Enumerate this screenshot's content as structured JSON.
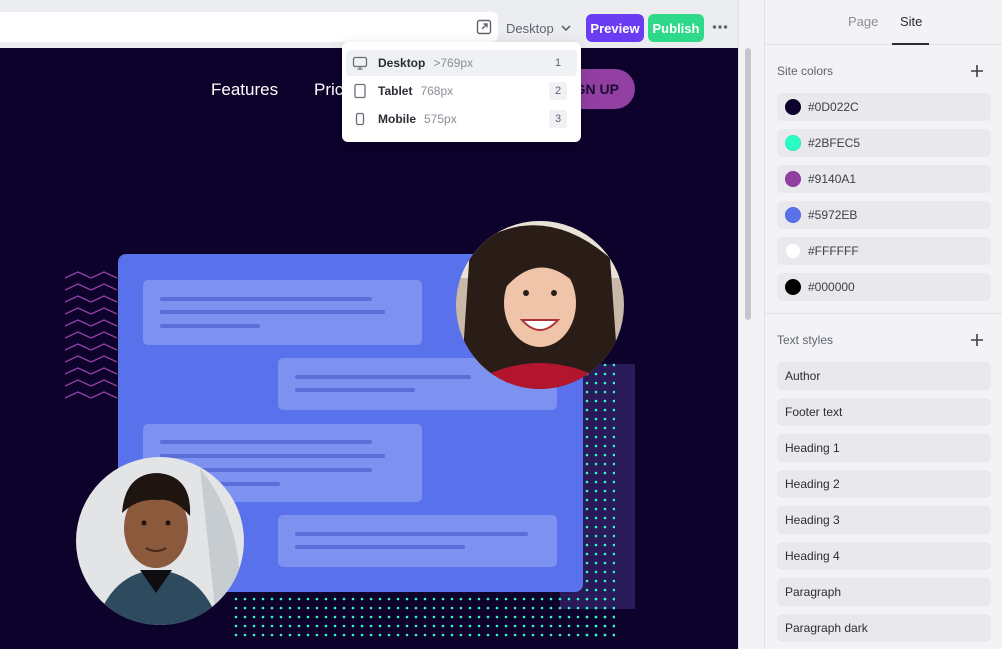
{
  "toolbar": {
    "device_label": "Desktop",
    "preview_label": "Preview",
    "publish_label": "Publish"
  },
  "site_preview": {
    "nav": {
      "features": "Features",
      "pricing_partial": "Pric",
      "signup_partial": "GN UP"
    },
    "colors": {
      "background": "#0D022C",
      "card": "#5972EB",
      "accent": "#9140A1",
      "dots": "#2BFEC5"
    }
  },
  "device_menu": {
    "items": [
      {
        "label": "Desktop",
        "size": ">769px",
        "key": "1",
        "icon": "desktop-icon"
      },
      {
        "label": "Tablet",
        "size": "768px",
        "key": "2",
        "icon": "tablet-icon"
      },
      {
        "label": "Mobile",
        "size": "575px",
        "key": "3",
        "icon": "mobile-icon"
      }
    ]
  },
  "panel": {
    "tabs": {
      "page": "Page",
      "site": "Site"
    },
    "active_tab": "Site",
    "site_colors": {
      "title": "Site colors",
      "items": [
        {
          "hex": "#0D022C"
        },
        {
          "hex": "#2BFEC5"
        },
        {
          "hex": "#9140A1"
        },
        {
          "hex": "#5972EB"
        },
        {
          "hex": "#FFFFFF"
        },
        {
          "hex": "#000000"
        }
      ]
    },
    "text_styles": {
      "title": "Text styles",
      "items": [
        "Author",
        "Footer text",
        "Heading 1",
        "Heading 2",
        "Heading 3",
        "Heading 4",
        "Paragraph",
        "Paragraph dark"
      ]
    }
  }
}
